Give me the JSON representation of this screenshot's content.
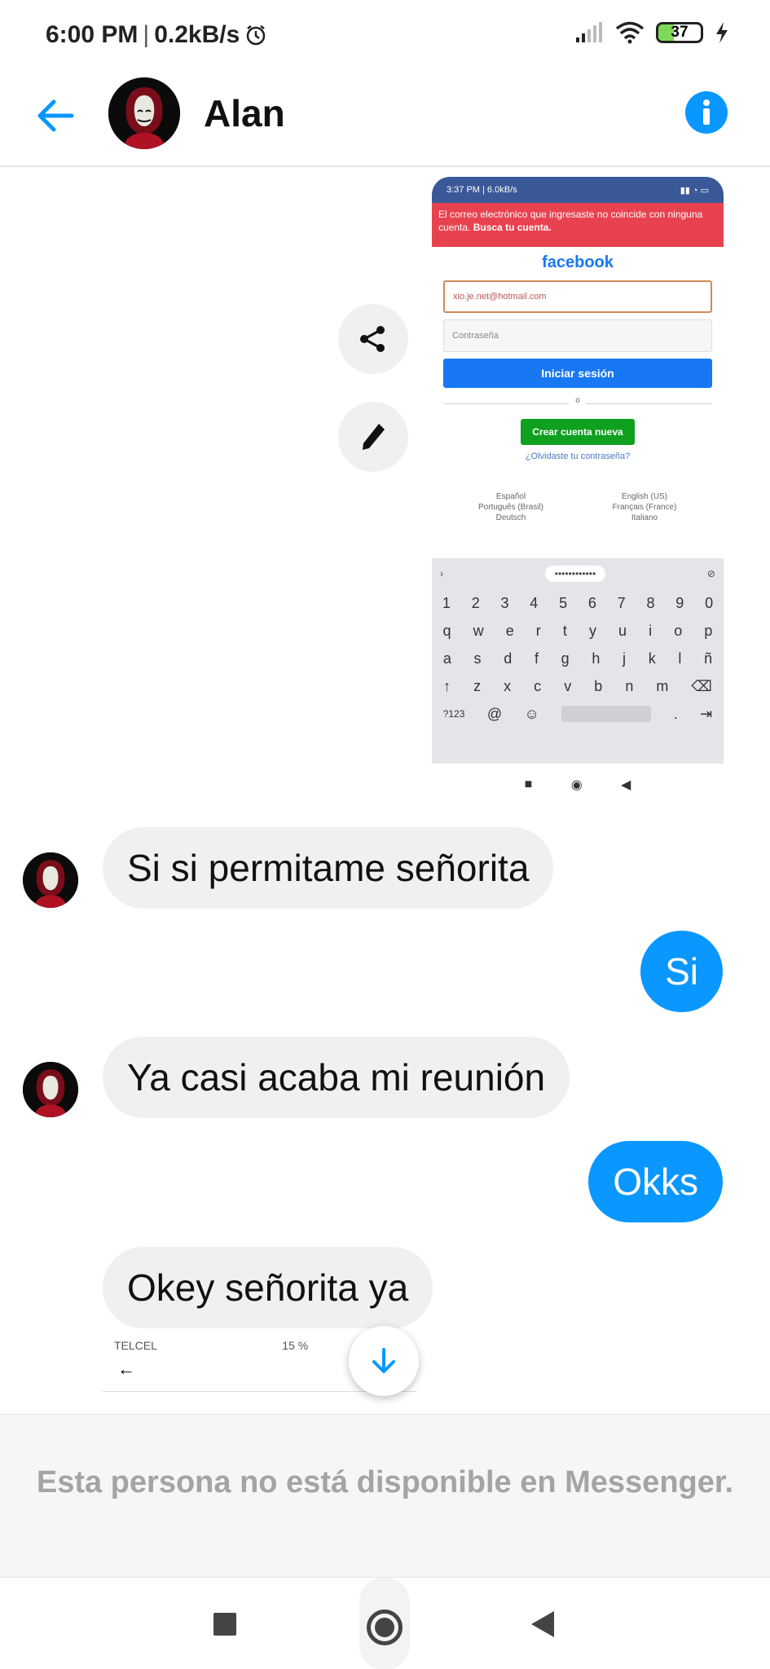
{
  "status_bar": {
    "time": "6:00 PM",
    "separator": "|",
    "speed": "0.2kB/s",
    "battery": "37",
    "battery_level_percent": 37,
    "icons": [
      "alarm-icon",
      "signal-icon",
      "wifi-icon",
      "battery-icon",
      "charging-icon"
    ]
  },
  "header": {
    "contact_name": "Alan",
    "back_icon": "arrow-left-icon",
    "info_icon": "info-icon",
    "accent_color": "#0a97ff"
  },
  "attachment": {
    "status_time": "3:37 PM | 6.0kB/s",
    "error_text": "El correo electrónico que ingresaste no coincide con ninguna cuenta.",
    "error_link": "Busca tu cuenta.",
    "logo": "facebook",
    "email_value": "xio.je.net@hotmail.com",
    "password_placeholder": "Contraseña",
    "login_label": "Iniciar sesión",
    "or_label": "o",
    "create_label": "Crear cuenta nueva",
    "forgot_label": "¿Olvidaste tu contraseña?",
    "languages": [
      "Español",
      "English (US)",
      "Português (Brasil)",
      "Français (France)",
      "Deutsch",
      "Italiano"
    ],
    "keyboard_field": "••••••••••••",
    "keyboard_rows": [
      [
        "1",
        "2",
        "3",
        "4",
        "5",
        "6",
        "7",
        "8",
        "9",
        "0"
      ],
      [
        "q",
        "w",
        "e",
        "r",
        "t",
        "y",
        "u",
        "i",
        "o",
        "p"
      ],
      [
        "a",
        "s",
        "d",
        "f",
        "g",
        "h",
        "j",
        "k",
        "l",
        "ñ"
      ],
      [
        "↑",
        "z",
        "x",
        "c",
        "v",
        "b",
        "n",
        "m",
        "⌫"
      ],
      [
        "?123",
        "@",
        "☺",
        " ",
        ".",
        "⇥"
      ]
    ]
  },
  "actions": {
    "share_icon": "share-icon",
    "edit_icon": "pencil-icon"
  },
  "messages": [
    {
      "direction": "in",
      "text": "Si si permitame señorita"
    },
    {
      "direction": "out",
      "text": "Si"
    },
    {
      "direction": "in",
      "text": "Ya casi acaba mi reunión"
    },
    {
      "direction": "out",
      "text": "Okks"
    },
    {
      "direction": "in",
      "text": "Okey señorita ya"
    }
  ],
  "partial_attachment": {
    "status": "TELCEL",
    "battery": "15 %"
  },
  "unavailable_notice": "Esta persona no está disponible en Messenger.",
  "nav": {
    "recents_icon": "square-icon",
    "home_icon": "home-circle-icon",
    "back_icon": "triangle-back-icon"
  }
}
